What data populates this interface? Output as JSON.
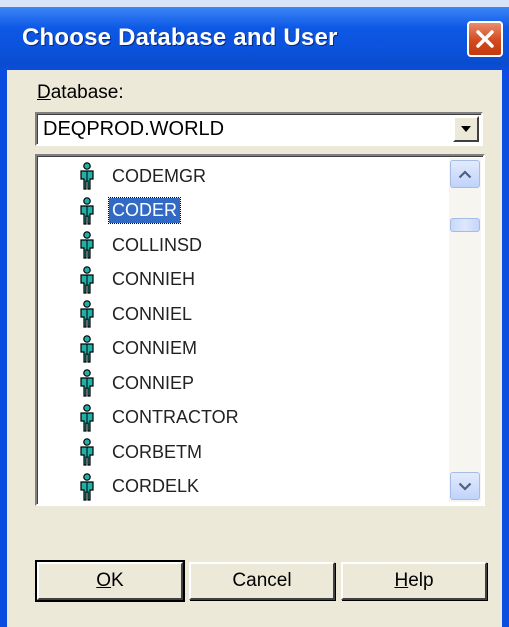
{
  "window": {
    "title": "Choose Database and User",
    "close_icon": "close-icon"
  },
  "database": {
    "label_prefix": "D",
    "label_rest": "atabase:",
    "selected_value": "DEQPROD.WORLD"
  },
  "user_list": {
    "icon": "user-icon",
    "selected": "CODER",
    "items": [
      {
        "label": "CODEMGR"
      },
      {
        "label": "CODER"
      },
      {
        "label": "COLLINSD"
      },
      {
        "label": "CONNIEH"
      },
      {
        "label": "CONNIEL"
      },
      {
        "label": "CONNIEM"
      },
      {
        "label": "CONNIEP"
      },
      {
        "label": "CONTRACTOR"
      },
      {
        "label": "CORBETM"
      },
      {
        "label": "CORDELK"
      }
    ]
  },
  "buttons": {
    "ok": {
      "label_underline": "O",
      "label_rest": "K"
    },
    "cancel": {
      "label": "Cancel"
    },
    "help": {
      "label_underline": "H",
      "label_rest": "elp"
    }
  },
  "colors": {
    "titlebar": "#0a4de0",
    "selection": "#316ac5",
    "dialog_face": "#ece9d8",
    "close_button": "#d4491f"
  }
}
